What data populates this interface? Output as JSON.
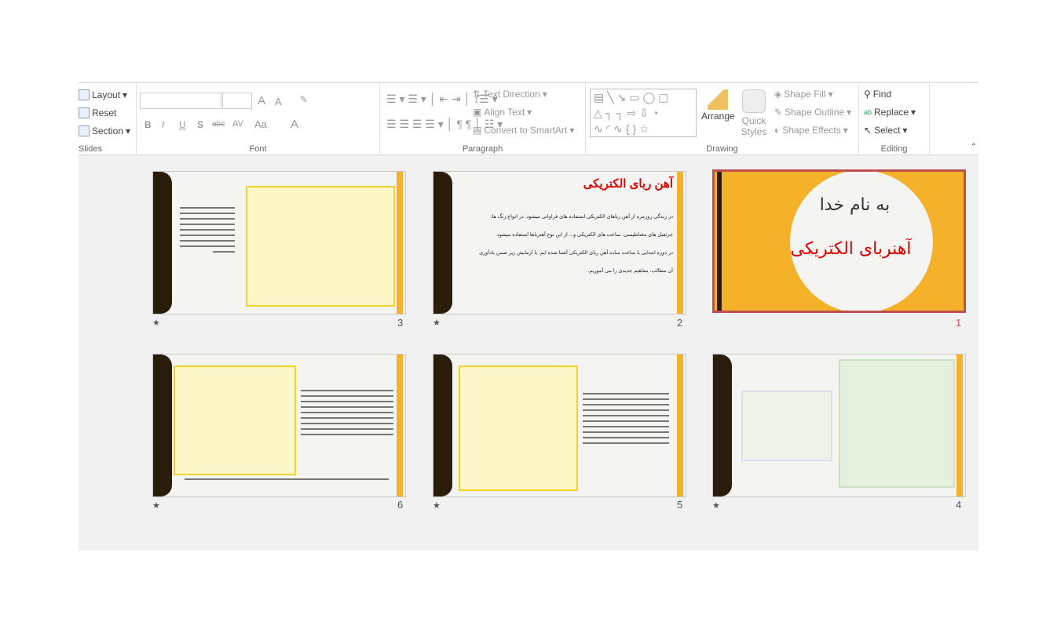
{
  "ribbon": {
    "slides": {
      "layout": "Layout",
      "reset": "Reset",
      "section": "Section",
      "label": "Slides"
    },
    "font": {
      "bold": "B",
      "italic": "I",
      "underline": "U",
      "shadow": "S",
      "strike": "abc",
      "spacing": "AV",
      "case": "Aa",
      "color": "A",
      "grow": "A",
      "shrink": "A",
      "label": "Font"
    },
    "paragraph": {
      "text_direction": "Text Direction",
      "align_text": "Align Text",
      "smartart": "Convert to SmartArt",
      "label": "Paragraph"
    },
    "drawing": {
      "arrange": "Arrange",
      "quick_styles": "Quick Styles",
      "shape_fill": "Shape Fill",
      "shape_outline": "Shape Outline",
      "shape_effects": "Shape Effects",
      "label": "Drawing"
    },
    "editing": {
      "find": "Find",
      "replace": "Replace",
      "select": "Select",
      "label": "Editing"
    }
  },
  "slides": [
    {
      "number": "1",
      "selected": true,
      "line1": "به نام خدا",
      "line2": "آهنربای الکتریکی"
    },
    {
      "number": "2",
      "title": "آهن ربای الکتریکی",
      "body": [
        "در زندگی روزمره از آهن رباهای الکتریکی استفاده های فراوانی میشود. در انواع زنگ ها،",
        "جرثقیل های مغناطیسی، ساعت های الکتریکی و... از این نوع آهنرباها استفاده میشود.",
        "در دوره ابتدایی با ساخت ساده آهن ربای الکتریکی آشنا شده ایم. با آزمایش زیر ضمن یادآوری",
        "آن مطالب، مفاهیم جدیدی را می آموزیم."
      ]
    },
    {
      "number": "3"
    },
    {
      "number": "4"
    },
    {
      "number": "5"
    },
    {
      "number": "6"
    }
  ],
  "colors": {
    "accent": "#f5b12a",
    "selection": "#c0504d",
    "title_red": "#e00000"
  }
}
